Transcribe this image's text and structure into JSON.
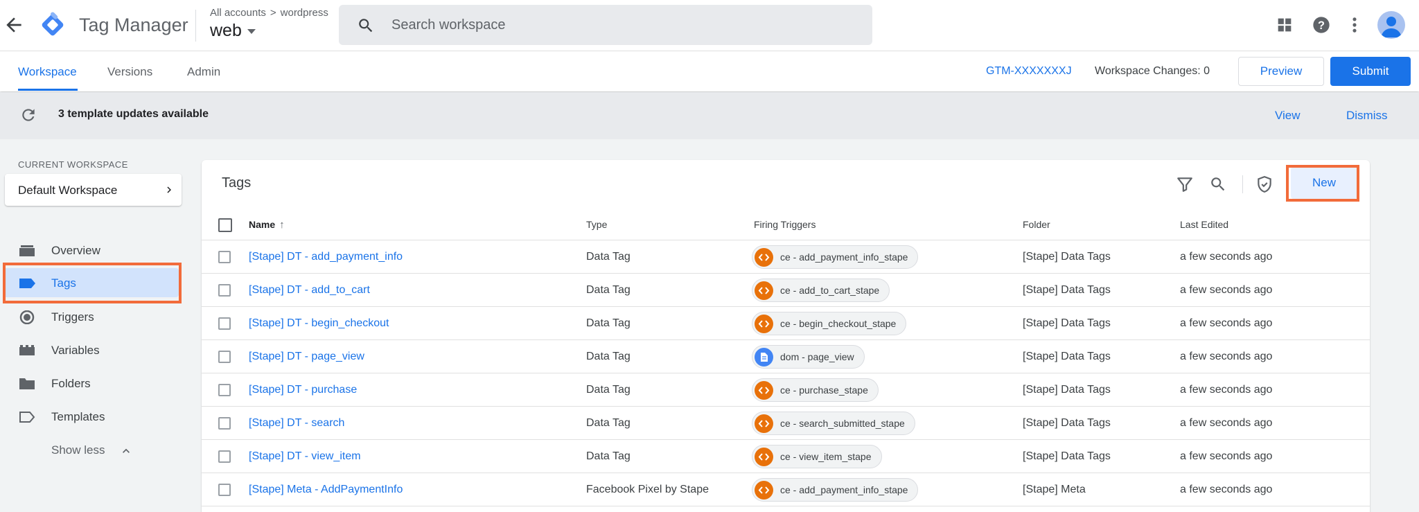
{
  "header": {
    "app_name": "Tag Manager",
    "breadcrumb": {
      "account": "All accounts",
      "container": "wordpress"
    },
    "container_name": "web",
    "search_placeholder": "Search workspace"
  },
  "nav": {
    "tabs": [
      "Workspace",
      "Versions",
      "Admin"
    ],
    "active_tab": "Workspace",
    "workspace_id": "GTM-XXXXXXXJ",
    "workspace_changes": "Workspace Changes: 0",
    "preview_label": "Preview",
    "submit_label": "Submit"
  },
  "banner": {
    "text": "3 template updates available",
    "view_label": "View",
    "dismiss_label": "Dismiss"
  },
  "sidebar": {
    "current_workspace_label": "CURRENT WORKSPACE",
    "workspace_name": "Default Workspace",
    "items": [
      {
        "label": "Overview",
        "icon": "overview-icon"
      },
      {
        "label": "Tags",
        "icon": "tag-icon"
      },
      {
        "label": "Triggers",
        "icon": "trigger-icon"
      },
      {
        "label": "Variables",
        "icon": "variable-icon"
      },
      {
        "label": "Folders",
        "icon": "folder-icon"
      },
      {
        "label": "Templates",
        "icon": "template-icon"
      }
    ],
    "active_item": "Tags",
    "show_less_label": "Show less"
  },
  "tags_table": {
    "title": "Tags",
    "new_label": "New",
    "columns": [
      "Name",
      "Type",
      "Firing Triggers",
      "Folder",
      "Last Edited"
    ],
    "rows": [
      {
        "name": "[Stape] DT - add_payment_info",
        "type": "Data Tag",
        "trigger": "ce - add_payment_info_stape",
        "trigger_kind": "ce",
        "folder": "[Stape] Data Tags",
        "edited": "a few seconds ago"
      },
      {
        "name": "[Stape] DT - add_to_cart",
        "type": "Data Tag",
        "trigger": "ce - add_to_cart_stape",
        "trigger_kind": "ce",
        "folder": "[Stape] Data Tags",
        "edited": "a few seconds ago"
      },
      {
        "name": "[Stape] DT - begin_checkout",
        "type": "Data Tag",
        "trigger": "ce - begin_checkout_stape",
        "trigger_kind": "ce",
        "folder": "[Stape] Data Tags",
        "edited": "a few seconds ago"
      },
      {
        "name": "[Stape] DT - page_view",
        "type": "Data Tag",
        "trigger": "dom - page_view",
        "trigger_kind": "dom",
        "folder": "[Stape] Data Tags",
        "edited": "a few seconds ago"
      },
      {
        "name": "[Stape] DT - purchase",
        "type": "Data Tag",
        "trigger": "ce - purchase_stape",
        "trigger_kind": "ce",
        "folder": "[Stape] Data Tags",
        "edited": "a few seconds ago"
      },
      {
        "name": "[Stape] DT - search",
        "type": "Data Tag",
        "trigger": "ce - search_submitted_stape",
        "trigger_kind": "ce",
        "folder": "[Stape] Data Tags",
        "edited": "a few seconds ago"
      },
      {
        "name": "[Stape] DT - view_item",
        "type": "Data Tag",
        "trigger": "ce - view_item_stape",
        "trigger_kind": "ce",
        "folder": "[Stape] Data Tags",
        "edited": "a few seconds ago"
      },
      {
        "name": "[Stape] Meta - AddPaymentInfo",
        "type": "Facebook Pixel by Stape",
        "trigger": "ce - add_payment_info_stape",
        "trigger_kind": "ce",
        "folder": "[Stape] Meta",
        "edited": "a few seconds ago"
      }
    ]
  },
  "colors": {
    "accent": "#1a73e8",
    "highlight": "#f26b3a",
    "custom_event_trigger": "#e8710a",
    "dom_trigger": "#4285f4"
  }
}
